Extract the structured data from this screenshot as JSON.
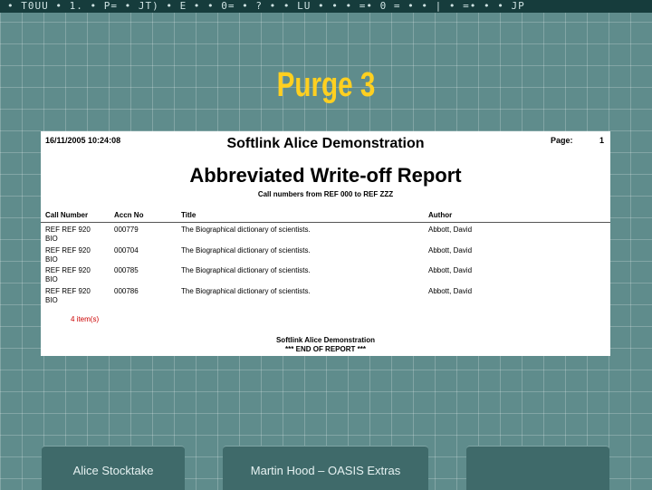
{
  "top_banner": "• T0UU  • 1. • P=  • JT) • E • • 0=  • ? • • LU • •  • =• 0  = • • | • =• • • JP",
  "slide": {
    "title": "Purge 3"
  },
  "report": {
    "datetime": "16/11/2005 10:24:08",
    "page_label": "Page:",
    "page_number": "1",
    "organization": "Softlink Alice Demonstration",
    "title": "Abbreviated Write-off Report",
    "range": "Call numbers from REF 000 to REF ZZZ",
    "columns": {
      "call_number": "Call Number",
      "accn_no": "Accn No",
      "title": "Title",
      "author": "Author"
    },
    "rows": [
      {
        "call_number": "REF REF 920",
        "bio": "BIO",
        "accn_no": "000779",
        "title": "The Biographical dictionary of scientists.",
        "author": "Abbott, David"
      },
      {
        "call_number": "REF REF 920",
        "bio": "BIO",
        "accn_no": "000704",
        "title": "The Biographical dictionary of scientists.",
        "author": "Abbott, David"
      },
      {
        "call_number": "REF REF 920",
        "bio": "BIO",
        "accn_no": "000785",
        "title": "The Biographical dictionary of scientists.",
        "author": "Abbott, David"
      },
      {
        "call_number": "REF REF 920",
        "bio": "BIO",
        "accn_no": "000786",
        "title": "The Biographical dictionary of scientists.",
        "author": "Abbott, David"
      }
    ],
    "item_count": "4 item(s)",
    "footer_org": "Softlink Alice Demonstration",
    "footer_end": "*** END OF REPORT ***"
  },
  "footer": {
    "left": "Alice Stocktake",
    "center": "Martin Hood – OASIS Extras",
    "right": ""
  },
  "colors": {
    "background": "#5f8c8c",
    "title": "#ffd020",
    "footer_box": "#3f6a6a",
    "top_banner": "#163c3c",
    "item_count": "#cc0000"
  }
}
